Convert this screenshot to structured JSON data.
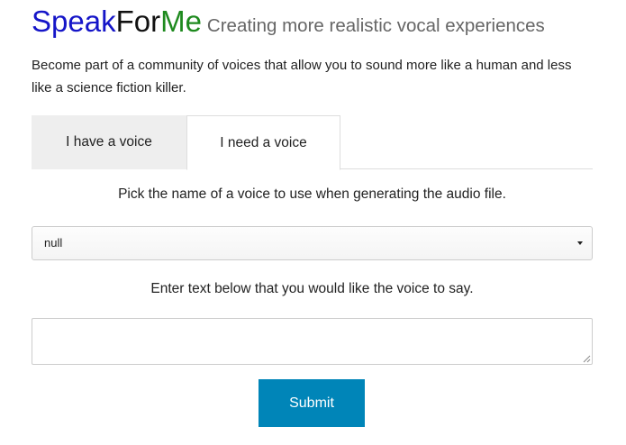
{
  "header": {
    "logo_part1": "Speak",
    "logo_part2": "For",
    "logo_part3": "Me",
    "tagline": "Creating more realistic vocal experiences"
  },
  "intro": "Become part of a community of voices that allow you to sound more like a human and less like a science fiction killer.",
  "tabs": [
    {
      "label": "I have a voice",
      "active": false
    },
    {
      "label": "I need a voice",
      "active": true
    }
  ],
  "voice_instruction": "Pick the name of a voice to use when generating the audio file.",
  "voice_select": {
    "value": "null"
  },
  "text_instruction": "Enter text below that you would like the voice to say.",
  "text_input": {
    "value": ""
  },
  "submit_label": "Submit",
  "colors": {
    "logo_blue": "#1515c8",
    "logo_green": "#1e8a1e",
    "submit_bg": "#0085b8"
  }
}
